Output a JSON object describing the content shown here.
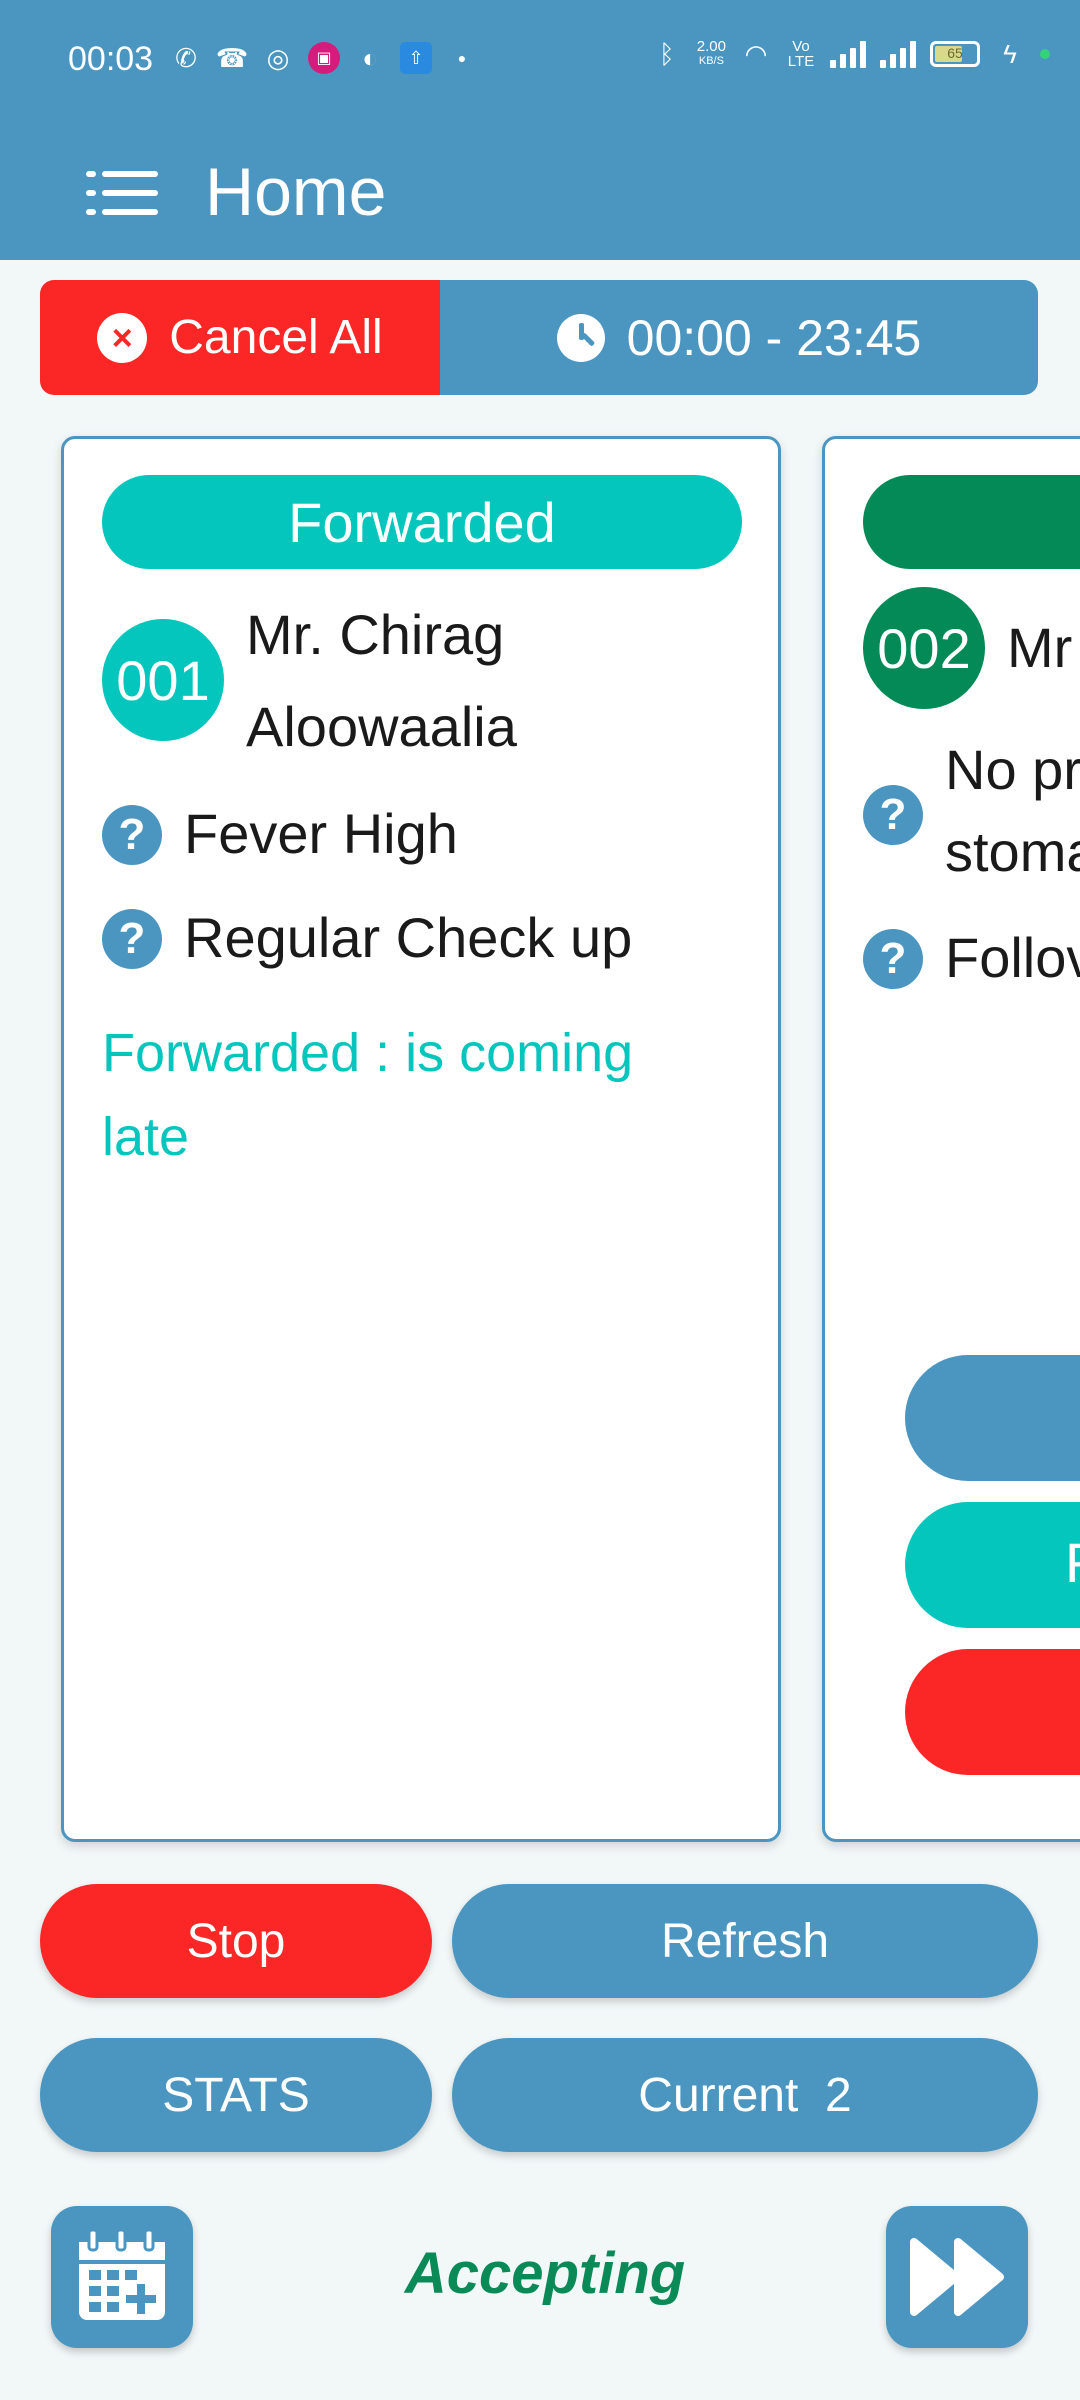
{
  "status_bar": {
    "time": "00:03",
    "net_speed_value": "2.00",
    "net_speed_unit": "KB/S",
    "volte": "Vo LTE",
    "battery_level": "65"
  },
  "app_bar": {
    "title": "Home",
    "menu_icon": "list-menu-icon"
  },
  "filter_bar": {
    "cancel_all_label": "Cancel All",
    "time_range": "00:00 - 23:45"
  },
  "cards": [
    {
      "status": "Forwarded",
      "status_color": "#04c6bd",
      "token": "001",
      "patient_name_line1": "Mr. Chirag",
      "patient_name_line2": "Aloowaalia",
      "reasons": [
        "Fever High",
        "Regular Check up"
      ],
      "note_line1": "Forwarded : is coming",
      "note_line2": "late"
    },
    {
      "status_color": "#048a56",
      "token": "002",
      "patient_name_partial": "Mr",
      "reason1_line1_partial": "No pr",
      "reason1_line2_partial": "stoma",
      "reason2_partial": "Follov",
      "partial_button_2_text": "F",
      "side_button_colors": [
        "#4a96c0",
        "#04c6bd",
        "#fb2626"
      ]
    }
  ],
  "controls": {
    "stop_label": "Stop",
    "refresh_label": "Refresh",
    "stats_label": "STATS",
    "current_label": "Current  2"
  },
  "footer": {
    "state_label": "Accepting",
    "calendar_icon": "calendar-add-icon",
    "next_icon": "fast-forward-icon"
  },
  "colors": {
    "primary": "#4a96c0",
    "danger": "#fb2626",
    "teal": "#04c6bd",
    "green": "#048a56",
    "accepting": "#0a8a57"
  }
}
